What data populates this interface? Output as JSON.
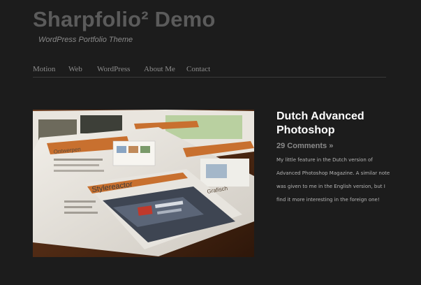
{
  "site": {
    "title": "Sharpfolio² Demo",
    "tagline": "WordPress Portfolio Theme"
  },
  "nav": {
    "items": [
      "Motion",
      "Web",
      "WordPress",
      "About Me",
      "Contact"
    ]
  },
  "post": {
    "title": "Dutch Advanced Photoshop",
    "comments": "29 Comments »",
    "excerpt": "My little feature in the Dutch version of Advanced Photoshop Magazine. A similar note was given to me in the English version, but I find it more interesting in the foreign one!"
  },
  "image": {
    "magazine_heading": "Stylereactor",
    "page_labels": [
      "Ontwerpen",
      "Grafisch"
    ]
  },
  "colors": {
    "background": "#1c1c1c",
    "title": "#5b5b5b",
    "post_title": "#ffffff",
    "accent_orange": "#c8702f"
  }
}
